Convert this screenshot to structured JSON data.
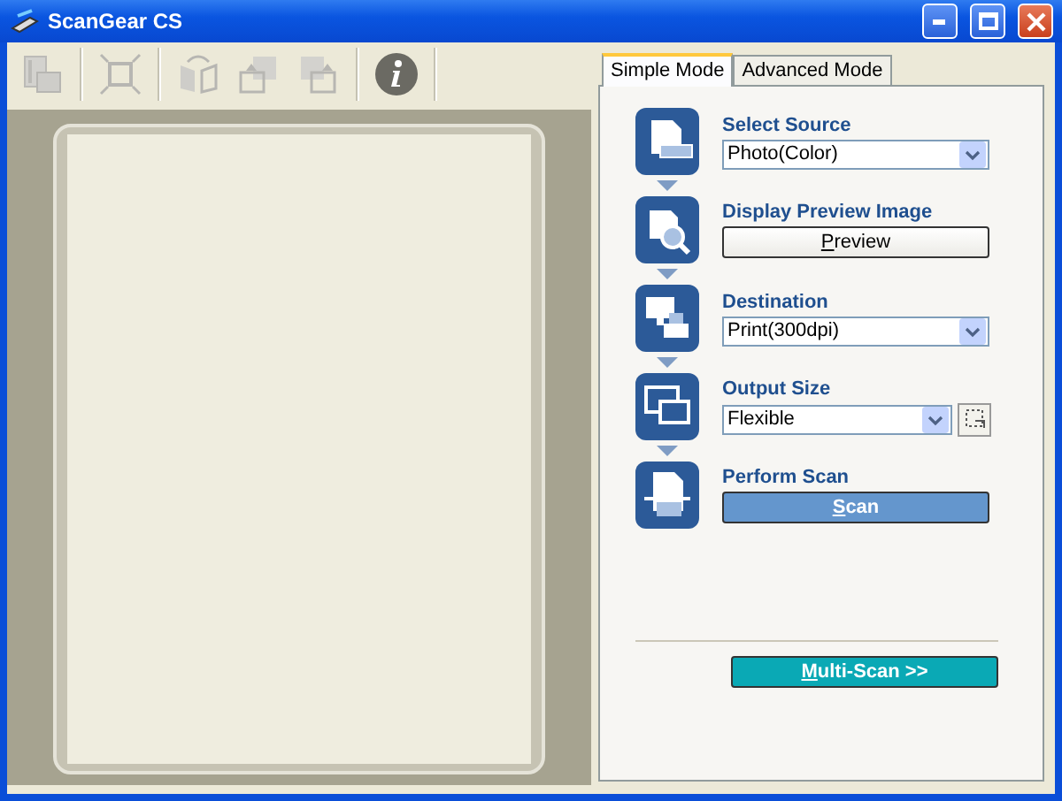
{
  "window": {
    "title": "ScanGear CS"
  },
  "toolbar": [
    {
      "kind": "thumbnails",
      "disabled": true
    },
    {
      "kind": "crop",
      "disabled": true
    },
    {
      "kind": "mirror",
      "disabled": true
    },
    {
      "kind": "rotate-left",
      "disabled": true
    },
    {
      "kind": "rotate-right",
      "disabled": true
    },
    {
      "kind": "info",
      "disabled": false
    }
  ],
  "tabs": [
    {
      "label": "Simple Mode",
      "selected": true
    },
    {
      "label": "Advanced Mode",
      "selected": false
    }
  ],
  "steps": [
    {
      "kind": "source",
      "title": "Select Source",
      "control": {
        "kind": "dropdown",
        "value": "Photo(Color)"
      }
    },
    {
      "kind": "preview",
      "title": "Display Preview Image",
      "control": {
        "kind": "button",
        "label": "Preview",
        "access_key_underlined": true
      }
    },
    {
      "kind": "destination",
      "title": "Destination",
      "control": {
        "kind": "dropdown",
        "value": "Print(300dpi)"
      }
    },
    {
      "kind": "size",
      "title": "Output Size",
      "control": {
        "kind": "dropdown-crop",
        "value": "Flexible"
      }
    },
    {
      "kind": "scan",
      "title": "Perform Scan",
      "control": {
        "kind": "primary-button",
        "label": "Scan",
        "access_key_underlined": true
      }
    }
  ],
  "multi_scan": {
    "label": "Multi-Scan >>",
    "access_key_underlined": true
  }
}
